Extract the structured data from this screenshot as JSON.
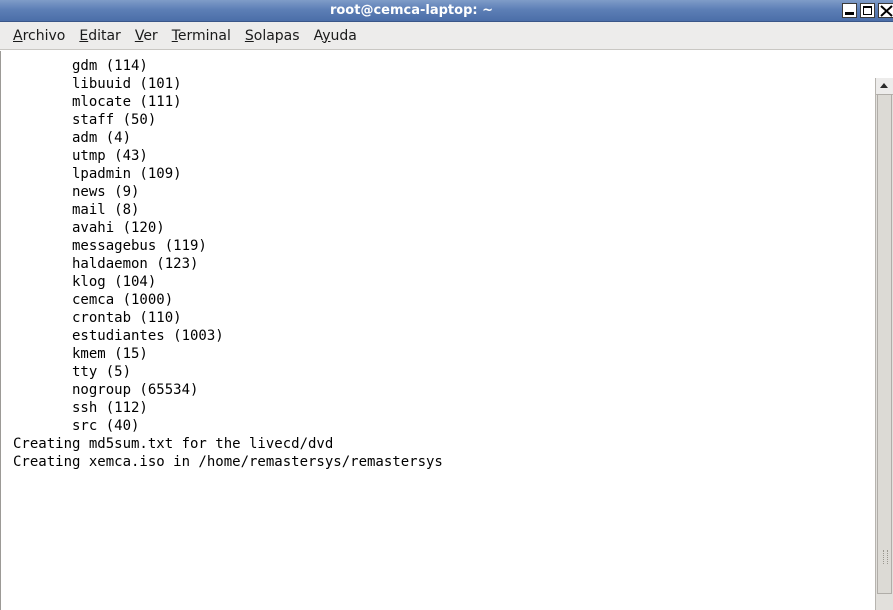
{
  "window": {
    "title": "root@cemca-laptop: ~"
  },
  "menubar": {
    "items": [
      {
        "mnemonic": "A",
        "rest": "rchivo"
      },
      {
        "mnemonic": "E",
        "rest": "ditar"
      },
      {
        "mnemonic": "V",
        "rest": "er"
      },
      {
        "mnemonic": "T",
        "rest": "erminal"
      },
      {
        "mnemonic": "S",
        "rest": "olapas"
      },
      {
        "pre": "A",
        "mnemonic": "y",
        "rest": "uda"
      }
    ]
  },
  "terminal": {
    "lines": [
      "       gdm (114)",
      "       libuuid (101)",
      "       mlocate (111)",
      "       staff (50)",
      "       adm (4)",
      "       utmp (43)",
      "       lpadmin (109)",
      "       news (9)",
      "       mail (8)",
      "       avahi (120)",
      "       messagebus (119)",
      "       haldaemon (123)",
      "       klog (104)",
      "       cemca (1000)",
      "       crontab (110)",
      "       estudiantes (1003)",
      "       kmem (15)",
      "       tty (5)",
      "       nogroup (65534)",
      "       ssh (112)",
      "       src (40)",
      "Creating md5sum.txt for the livecd/dvd",
      "Creating xemca.iso in /home/remastersys/remastersys"
    ]
  },
  "colors": {
    "titlebar": "#5d7fb6",
    "menubar": "#edeceb",
    "terminal_bg": "#ffffff",
    "terminal_fg": "#000000"
  }
}
